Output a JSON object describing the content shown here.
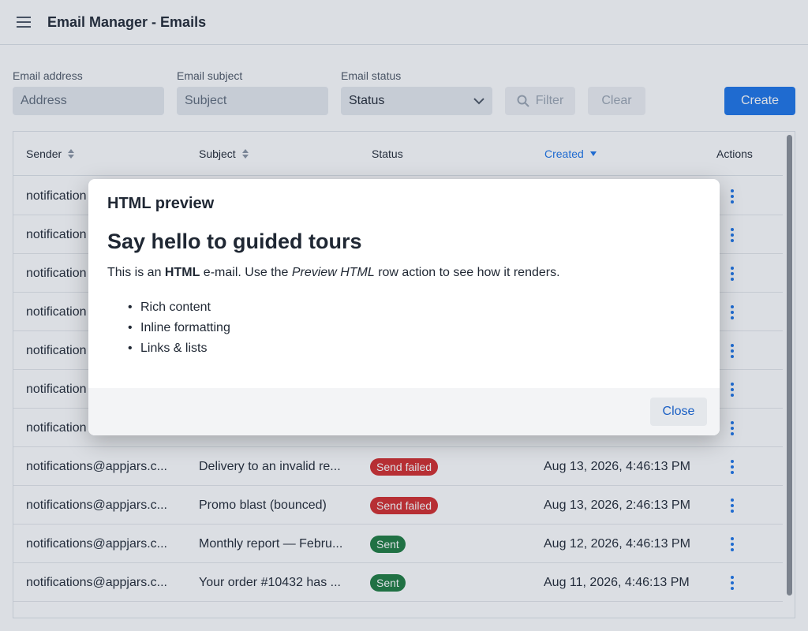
{
  "app": {
    "title": "Email Manager - Emails"
  },
  "filters": {
    "address_label": "Email address",
    "address_placeholder": "Address",
    "subject_label": "Email subject",
    "subject_placeholder": "Subject",
    "status_label": "Email status",
    "status_value": "Status",
    "filter_label": "Filter",
    "clear_label": "Clear",
    "create_label": "Create"
  },
  "grid": {
    "columns": {
      "sender": "Sender",
      "subject": "Subject",
      "status": "Status",
      "created": "Created",
      "actions": "Actions"
    },
    "rows": [
      {
        "sender": "notification",
        "subject": "",
        "status": "",
        "created": ""
      },
      {
        "sender": "notification",
        "subject": "",
        "status": "",
        "created": ""
      },
      {
        "sender": "notification",
        "subject": "",
        "status": "",
        "created": ""
      },
      {
        "sender": "notification",
        "subject": "",
        "status": "",
        "created": ""
      },
      {
        "sender": "notification",
        "subject": "",
        "status": "",
        "created": ""
      },
      {
        "sender": "notification",
        "subject": "",
        "status": "",
        "created": ""
      },
      {
        "sender": "notification",
        "subject": "",
        "status": "",
        "created": ""
      },
      {
        "sender": "notifications@appjars.c...",
        "subject": "Delivery to an invalid re...",
        "status": "Send failed",
        "created": "Aug 13, 2026, 4:46:13 PM"
      },
      {
        "sender": "notifications@appjars.c...",
        "subject": "Promo blast (bounced)",
        "status": "Send failed",
        "created": "Aug 13, 2026, 2:46:13 PM"
      },
      {
        "sender": "notifications@appjars.c...",
        "subject": "Monthly report — Febru...",
        "status": "Sent",
        "created": "Aug 12, 2026, 4:46:13 PM"
      },
      {
        "sender": "notifications@appjars.c...",
        "subject": "Your order #10432 has ...",
        "status": "Sent",
        "created": "Aug 11, 2026, 4:46:13 PM"
      }
    ]
  },
  "dialog": {
    "title": "HTML preview",
    "heading": "Say hello to guided tours",
    "p_before": "This is an ",
    "p_bold": "HTML",
    "p_mid": " e-mail. Use the ",
    "p_italic": "Preview HTML",
    "p_after": " row action to see how it renders.",
    "list": [
      "Rich content",
      "Inline formatting",
      "Links & lists"
    ],
    "close_label": "Close"
  },
  "colors": {
    "accent": "#1a73e8",
    "failed": "#d42a2a",
    "sent": "#1b7a3e"
  }
}
